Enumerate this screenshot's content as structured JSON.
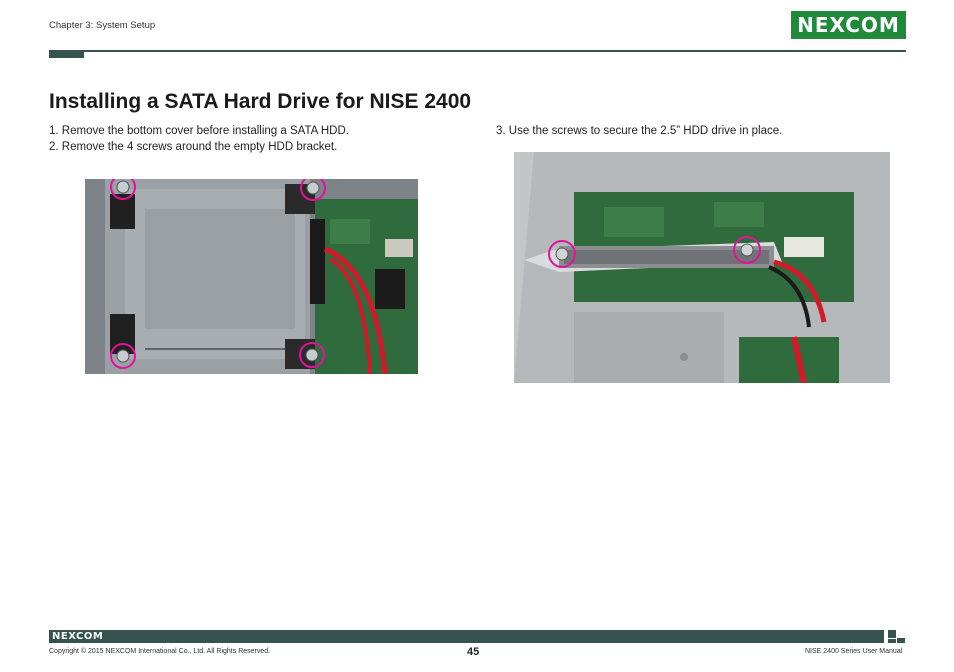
{
  "header": {
    "chapter": "Chapter 3: System Setup",
    "logo_text": "NEXCOM"
  },
  "title": "Installing a SATA Hard Drive for NISE 2400",
  "steps": [
    "1. Remove the bottom cover before installing a SATA HDD.",
    "2. Remove the 4 screws around the empty HDD bracket.",
    "3. Use the screws to secure the 2.5” HDD drive in place."
  ],
  "footer": {
    "logo_text": "NEXCOM",
    "copyright": "Copyright © 2015 NEXCOM International Co., Ltd. All Rights Reserved.",
    "page_number": "45",
    "manual_title": "NISE 2400 Series User Manual"
  },
  "colors": {
    "brand_green": "#1f8a3a",
    "bar": "#35544f",
    "highlight_circle": "#e0139a"
  }
}
